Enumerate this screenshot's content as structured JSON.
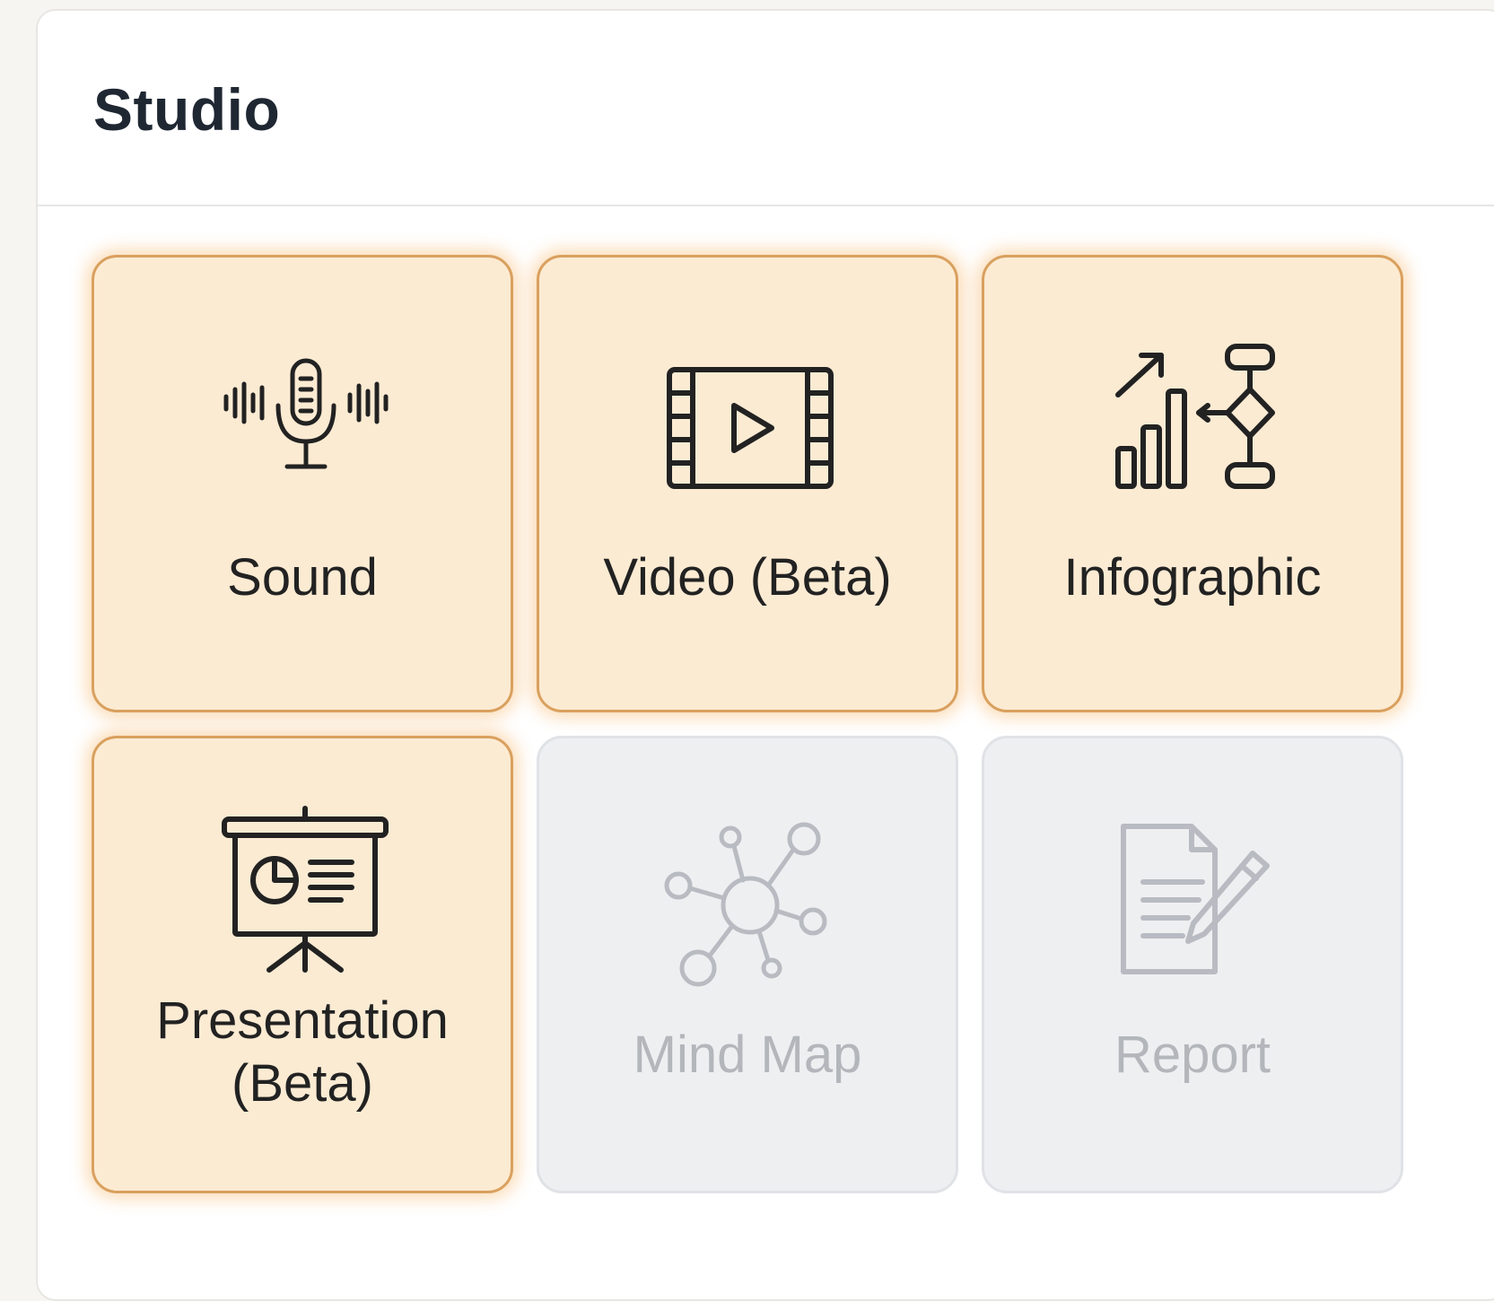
{
  "panel": {
    "title": "Studio"
  },
  "tiles": [
    {
      "label": "Sound",
      "icon": "microphone-soundwave-icon",
      "state": "enabled"
    },
    {
      "label": "Video (Beta)",
      "icon": "film-play-icon",
      "state": "enabled"
    },
    {
      "label": "Infographic",
      "icon": "chart-flowchart-icon",
      "state": "enabled"
    },
    {
      "label": "Presentation\n(Beta)",
      "icon": "presentation-board-icon",
      "state": "enabled"
    },
    {
      "label": "Mind Map",
      "icon": "mind-map-network-icon",
      "state": "disabled"
    },
    {
      "label": "Report",
      "icon": "document-pen-icon",
      "state": "disabled"
    }
  ],
  "colors": {
    "active_tile_bg": "#fcebd3",
    "active_tile_border": "#d9a05e",
    "disabled_tile_bg": "#eeeff1",
    "disabled_text": "#b3b6bb"
  }
}
